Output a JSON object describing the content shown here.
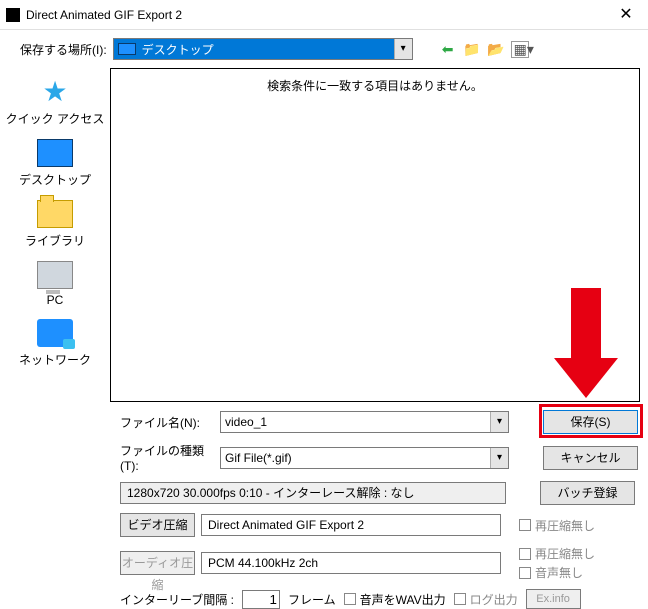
{
  "window": {
    "title": "Direct Animated GIF Export 2"
  },
  "location": {
    "label": "保存する場所(I):",
    "value": "デスクトップ"
  },
  "places": {
    "quick_access": "クイック アクセス",
    "desktop": "デスクトップ",
    "libraries": "ライブラリ",
    "pc": "PC",
    "network": "ネットワーク"
  },
  "file_area": {
    "empty_message": "検索条件に一致する項目はありません。"
  },
  "filename": {
    "label": "ファイル名(N):",
    "value": "video_1"
  },
  "filetype": {
    "label": "ファイルの種類(T):",
    "value": "Gif File(*.gif)"
  },
  "buttons": {
    "save": "保存(S)",
    "cancel": "キャンセル",
    "batch": "バッチ登録",
    "video_comp": "ビデオ圧縮",
    "audio_comp": "オーディオ圧縮",
    "ex_info": "Ex.info"
  },
  "media_info": {
    "summary": "1280x720  30.000fps  0:10  -  インターレース解除 : なし",
    "video_codec": "Direct Animated GIF Export 2",
    "audio_codec": "PCM 44.100kHz 2ch"
  },
  "checks": {
    "video_recomp_none": "再圧縮無し",
    "audio_recomp_none": "再圧縮無し",
    "audio_none": "音声無し",
    "wav_out": "音声をWAV出力",
    "log_out": "ログ出力"
  },
  "interleave": {
    "label": "インターリーブ間隔 :",
    "value": "1",
    "unit": "フレーム"
  }
}
